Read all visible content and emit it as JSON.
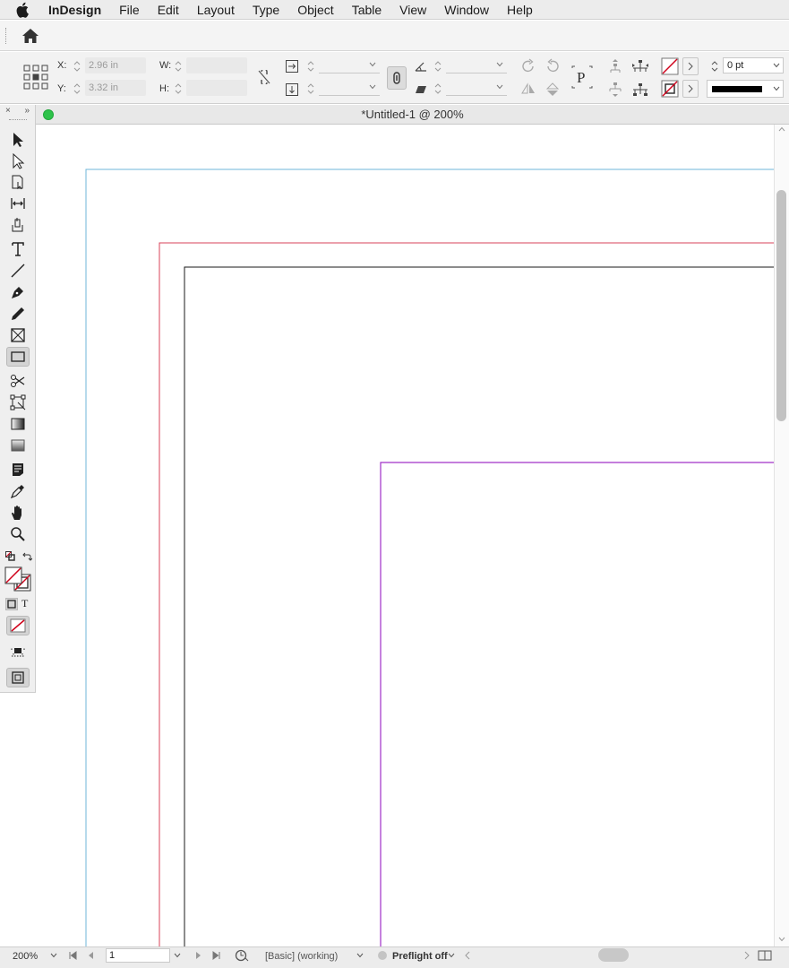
{
  "menubar": {
    "app_name": "InDesign",
    "items": [
      "File",
      "Edit",
      "Layout",
      "Type",
      "Object",
      "Table",
      "View",
      "Window",
      "Help"
    ]
  },
  "control": {
    "x_label": "X:",
    "x_value": "2.96 in",
    "y_label": "Y:",
    "y_value": "3.32 in",
    "w_label": "W:",
    "h_label": "H:",
    "stroke_weight": "0 pt"
  },
  "toolbox": {
    "close_glyph": "×",
    "collapse_glyph": "»",
    "tools": [
      "selection-tool",
      "direct-selection-tool",
      "page-tool",
      "gap-tool",
      "content-collector-tool",
      "type-tool",
      "line-tool",
      "pen-tool",
      "pencil-tool",
      "rectangle-frame-tool",
      "rectangle-tool",
      "scissors-tool",
      "free-transform-tool",
      "gradient-swatch-tool",
      "gradient-feather-tool",
      "note-tool",
      "eyedropper-tool",
      "hand-tool",
      "zoom-tool"
    ],
    "selected_tool": "rectangle-tool",
    "formatting_text_glyph": "T"
  },
  "document": {
    "title": "*Untitled-1 @ 200%"
  },
  "statusbar": {
    "zoom": "200%",
    "page": "1",
    "profile": "[Basic] (working)",
    "preflight": "Preflight off"
  },
  "colors": {
    "bleed_guide": "#6fb4d8",
    "margin_guide": "#d8435a",
    "page_edge": "#1a1a1a",
    "frame_guide": "#a030c8",
    "status_dot": "#2ec24a"
  }
}
